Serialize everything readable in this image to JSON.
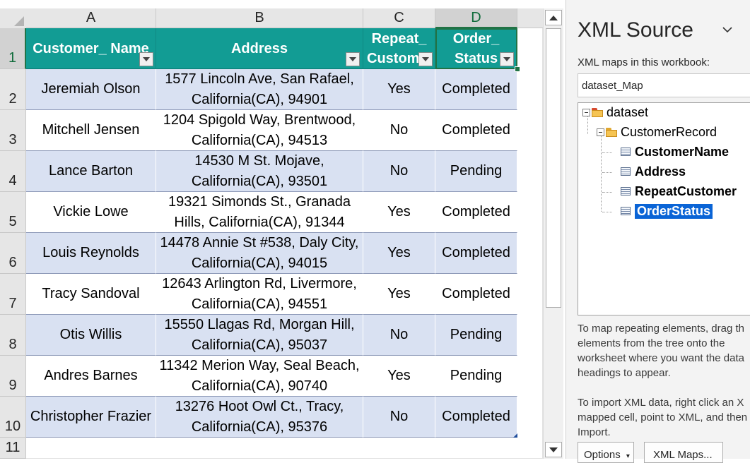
{
  "sheet": {
    "columns": [
      "A",
      "B",
      "C",
      "D"
    ],
    "rows": [
      "1",
      "2",
      "3",
      "4",
      "5",
      "6",
      "7",
      "8",
      "9",
      "10",
      "11"
    ],
    "headers": {
      "customer_name": "Customer_ Name",
      "address": "Address",
      "repeat_line1": "Repeat_",
      "repeat_line2": "Custom",
      "order_line1": "Order_",
      "order_line2": "Status"
    },
    "records": [
      {
        "name": "Jeremiah Olson",
        "addr1": "1577 Lincoln Ave, San Rafael,",
        "addr2": "California(CA), 94901",
        "repeat": "Yes",
        "status": "Completed"
      },
      {
        "name": "Mitchell Jensen",
        "addr1": "1204 Spigold Way, Brentwood,",
        "addr2": "California(CA), 94513",
        "repeat": "No",
        "status": "Completed"
      },
      {
        "name": "Lance Barton",
        "addr1": "14530 M St. Mojave,",
        "addr2": "California(CA), 93501",
        "repeat": "No",
        "status": "Pending"
      },
      {
        "name": "Vickie Lowe",
        "addr1": "19321 Simonds St., Granada",
        "addr2": "Hills, California(CA), 91344",
        "repeat": "Yes",
        "status": "Completed"
      },
      {
        "name": "Louis Reynolds",
        "addr1": "14478 Annie St #538, Daly City,",
        "addr2": "California(CA), 94015",
        "repeat": "Yes",
        "status": "Completed"
      },
      {
        "name": "Tracy Sandoval",
        "addr1": "12643 Arlington Rd, Livermore,",
        "addr2": "California(CA), 94551",
        "repeat": "Yes",
        "status": "Completed"
      },
      {
        "name": "Otis Willis",
        "addr1": "15550 Llagas Rd, Morgan Hill,",
        "addr2": "California(CA), 95037",
        "repeat": "No",
        "status": "Pending"
      },
      {
        "name": "Andres Barnes",
        "addr1": "11342 Merion Way, Seal Beach,",
        "addr2": "California(CA), 90740",
        "repeat": "Yes",
        "status": "Pending"
      },
      {
        "name": "Christopher Frazier",
        "addr1": "13276 Hoot Owl Ct., Tracy,",
        "addr2": "California(CA), 95376",
        "repeat": "No",
        "status": "Completed"
      }
    ],
    "colors": {
      "header_fill": "#129c94",
      "band_fill": "#d9e1f2",
      "selection": "#217346"
    }
  },
  "pane": {
    "title": "XML Source",
    "maps_label": "XML maps in this workbook:",
    "selected_map": "dataset_Map",
    "tree": {
      "root": "dataset",
      "record": "CustomerRecord",
      "elements": [
        "CustomerName",
        "Address",
        "RepeatCustomer",
        "OrderStatus"
      ],
      "selected": "OrderStatus"
    },
    "help1": [
      "To map repeating elements, drag th",
      "elements from the tree onto the",
      "worksheet where you want the data",
      "headings to appear."
    ],
    "help2": [
      "To import XML data, right click an X",
      "mapped cell, point to XML, and then",
      "Import."
    ],
    "options_button": "Options",
    "xml_maps_button": "XML Maps..."
  }
}
